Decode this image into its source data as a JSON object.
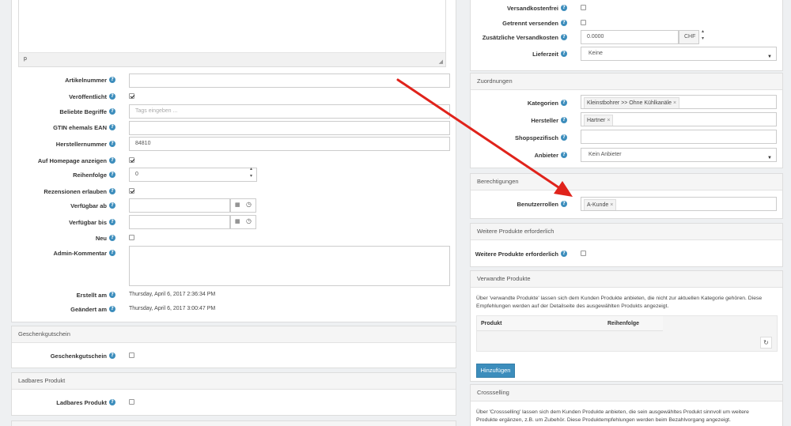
{
  "left": {
    "editor": {
      "status_path": "p"
    },
    "fields": {
      "artikelnummer": {
        "label": "Artikelnummer",
        "value": ""
      },
      "veroeffentlicht": {
        "label": "Veröffentlicht",
        "checked": true
      },
      "beliebte_begriffe": {
        "label": "Beliebte Begriffe",
        "placeholder": "Tags eingeben ..."
      },
      "gtin": {
        "label": "GTIN ehemals EAN",
        "value": ""
      },
      "herstellernummer": {
        "label": "Herstellernummer",
        "value": "84810"
      },
      "homepage": {
        "label": "Auf Homepage anzeigen",
        "checked": true
      },
      "reihenfolge": {
        "label": "Reihenfolge",
        "value": "0"
      },
      "rezensionen": {
        "label": "Rezensionen erlauben",
        "checked": true
      },
      "verfuegbar_ab": {
        "label": "Verfügbar ab",
        "value": ""
      },
      "verfuegbar_bis": {
        "label": "Verfügbar bis",
        "value": ""
      },
      "neu": {
        "label": "Neu",
        "checked": false
      },
      "admin_kommentar": {
        "label": "Admin-Kommentar",
        "value": ""
      },
      "erstellt_am": {
        "label": "Erstellt am",
        "value": "Thursday, April 6, 2017 2:36:34 PM"
      },
      "geaendert_am": {
        "label": "Geändert am",
        "value": "Thursday, April 6, 2017 3:00:47 PM"
      }
    },
    "geschenkgutschein": {
      "title": "Geschenkgutschein",
      "label": "Geschenkgutschein",
      "checked": false
    },
    "ladbares": {
      "title": "Ladbares Produkt",
      "label": "Ladbares Produkt",
      "checked": false
    }
  },
  "right": {
    "versand": {
      "versandkostenfrei": {
        "label": "Versandkostenfrei",
        "checked": false
      },
      "getrennt": {
        "label": "Getrennt versenden",
        "checked": false
      },
      "zusaetzliche": {
        "label": "Zusätzliche Versandkosten",
        "value": "0.0000",
        "unit": "CHF"
      },
      "lieferzeit": {
        "label": "Lieferzeit",
        "value": "Keine"
      }
    },
    "zuordnungen": {
      "title": "Zuordnungen",
      "kategorien": {
        "label": "Kategorien",
        "tag": "Kleinstbohrer >> Ohne Kühlkanäle"
      },
      "hersteller": {
        "label": "Hersteller",
        "tag": "Hartner"
      },
      "shopspezifisch": {
        "label": "Shopspezifisch",
        "value": ""
      },
      "anbieter": {
        "label": "Anbieter",
        "value": "Kein Anbieter"
      }
    },
    "berechtigungen": {
      "title": "Berechtigungen",
      "benutzerrollen": {
        "label": "Benutzerrollen",
        "tag": "A-Kunde"
      }
    },
    "weitere": {
      "title": "Weitere Produkte erforderlich",
      "label": "Weitere Produkte erforderlich",
      "checked": false
    },
    "verwandte": {
      "title": "Verwandte Produkte",
      "description_line1": "Über 'verwandte Produkte' lassen sich dem Kunden Produkte anbieten, die nicht zur aktuellen Kategorie gehören. Diese",
      "description_line2": "Empfehlungen werden auf der Detailseite des ausgewählten Produkts angezeigt.",
      "col_produkt": "Produkt",
      "col_reihenfolge": "Reihenfolge",
      "add_button": "Hinzufügen"
    },
    "crossselling": {
      "title": "Crossselling",
      "description_line1": "Über 'Crossselling' lassen sich dem Kunden Produkte anbieten, die sein ausgewähltes Produkt sinnvoll um weitere",
      "description_line2": "Produkte ergänzen, z.B. um Zubehör. Diese Produktempfehlungen werden beim Bezahlvorgang angezeigt."
    }
  },
  "icons": {
    "help": "question-circle-icon",
    "calendar": "calendar-icon",
    "clock": "clock-icon",
    "refresh": "refresh-icon",
    "resize": "resize-handle-icon"
  },
  "colors": {
    "accent": "#3c8dbc",
    "arrow": "#e0231b",
    "background": "#eef0f2"
  }
}
